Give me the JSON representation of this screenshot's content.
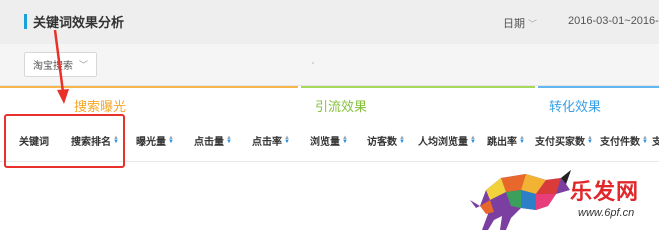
{
  "header": {
    "title": "关键词效果分析",
    "date_label": "日期",
    "date_range": "2016-03-01~2016-0"
  },
  "filter": {
    "select_value": "淘宝搜索"
  },
  "groups": {
    "search": "搜索曝光",
    "flow": "引流效果",
    "conversion": "转化效果"
  },
  "columns": [
    "关键词",
    "搜索排名",
    "曝光量",
    "点击量",
    "点击率",
    "浏览量",
    "访客数",
    "人均浏览量",
    "跳出率",
    "支付买家数",
    "支付件数",
    "支"
  ],
  "logo": {
    "text": "乐发网",
    "url": "www.6pf.cn"
  },
  "colors": {
    "search": "#f6a623",
    "flow": "#86c03c",
    "conversion": "#39a0e6",
    "highlight": "#e8312b",
    "accent": "#1aa1d9"
  }
}
